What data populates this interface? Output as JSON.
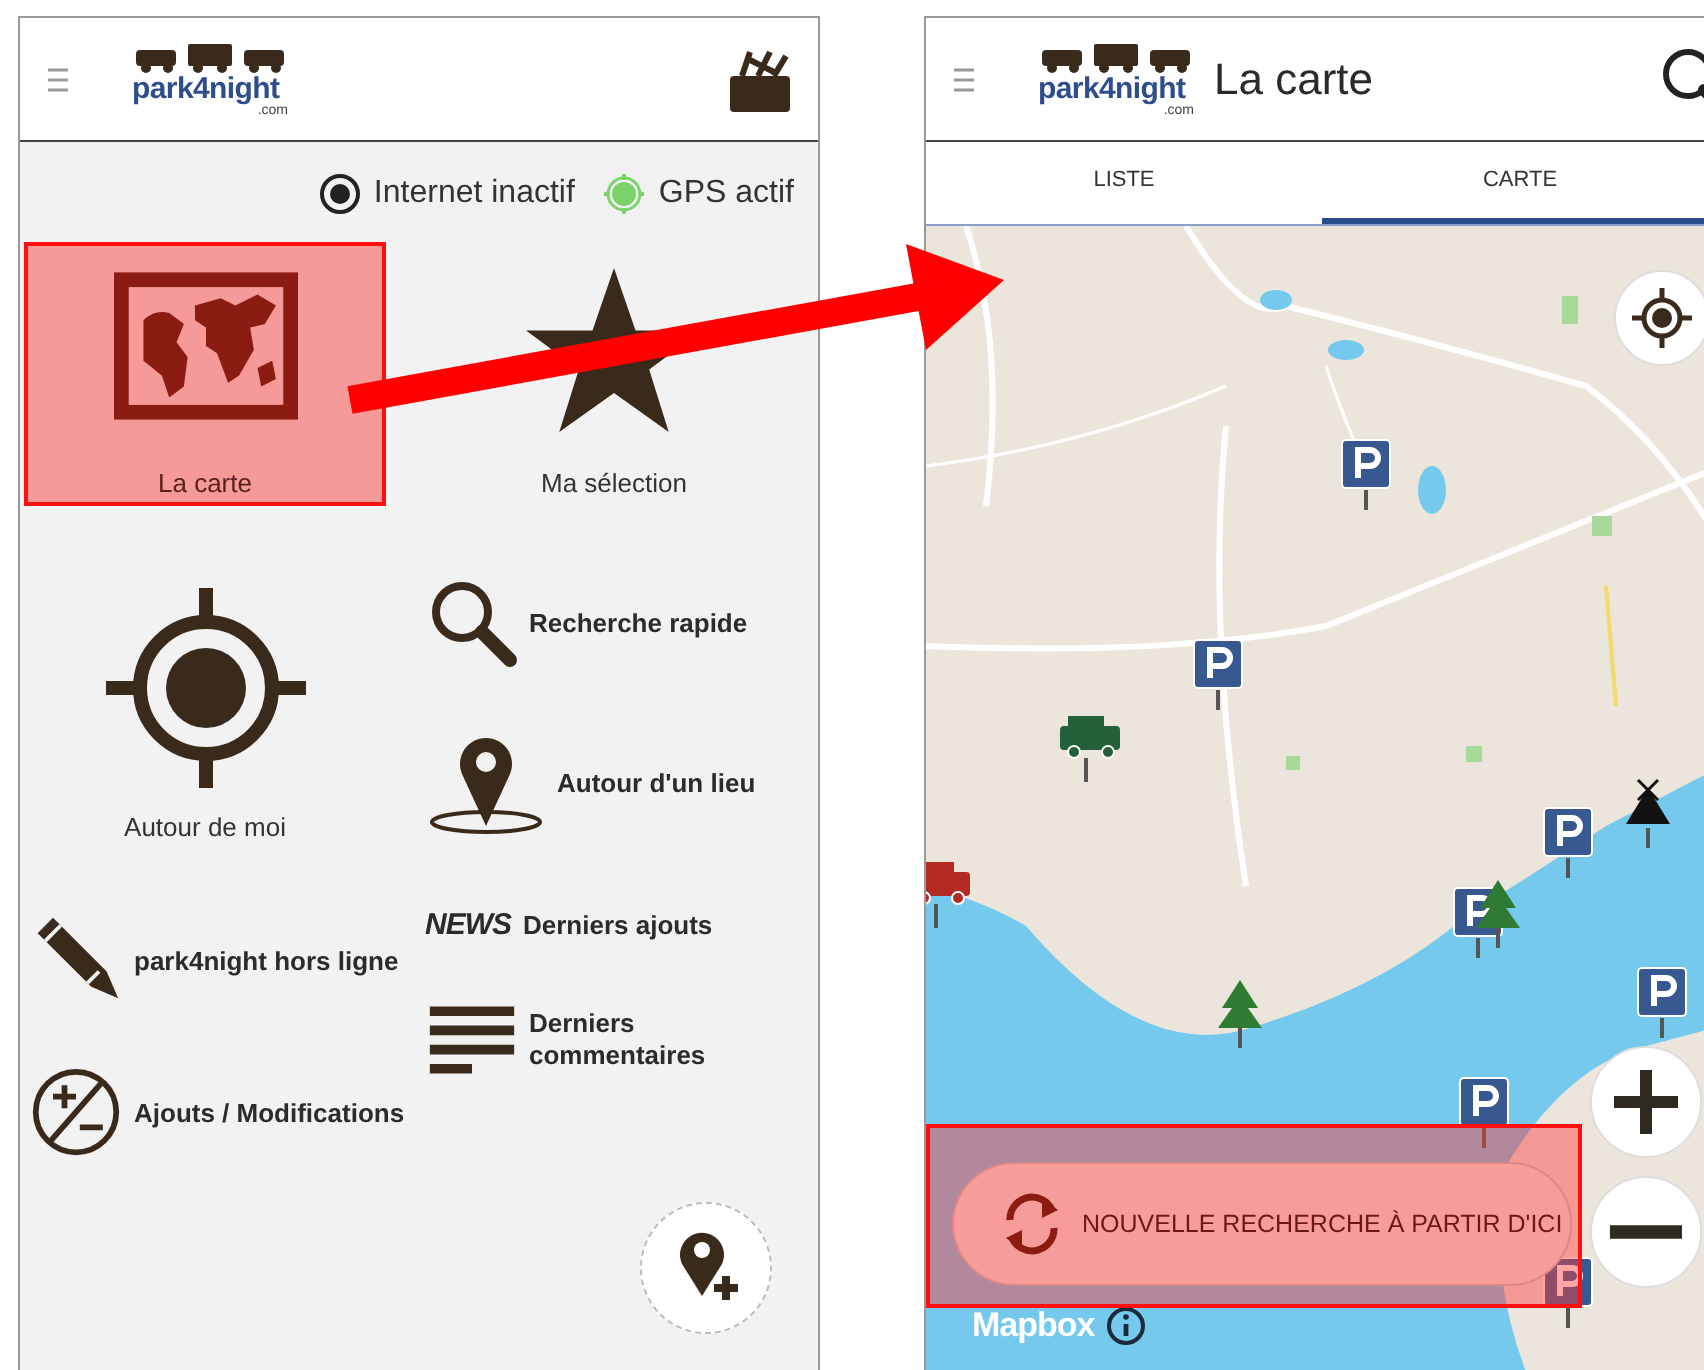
{
  "left_screen": {
    "header": {
      "logo": "park4night",
      "logo_domain": ".com"
    },
    "status": [
      {
        "kind": "internet",
        "label": "Internet inactif",
        "active": false
      },
      {
        "kind": "gps",
        "label": "GPS actif",
        "active": true
      }
    ],
    "menu_columns": [
      [
        {
          "kind": "tile",
          "label": "La carte",
          "highlighted": true
        },
        {
          "kind": "tile",
          "label": "Autour de moi",
          "highlighted": false
        },
        {
          "kind": "row",
          "label": "park4night hors ligne"
        },
        {
          "kind": "row",
          "label": "Ajouts / Modifications"
        }
      ],
      [
        {
          "kind": "tile",
          "label": "Ma sélection",
          "highlighted": false
        },
        {
          "kind": "row",
          "label": "Recherche rapide"
        },
        {
          "kind": "row",
          "label": "Autour d'un lieu"
        },
        {
          "kind": "row",
          "label": "Derniers ajouts",
          "icon_text": "NEWS"
        },
        {
          "kind": "row",
          "label": "Derniers commentaires"
        }
      ]
    ]
  },
  "right_screen": {
    "header": {
      "logo": "park4night",
      "logo_domain": ".com",
      "title": "La carte"
    },
    "tabs": [
      {
        "label": "LISTE",
        "selected": false
      },
      {
        "label": "CARTE",
        "selected": true
      }
    ],
    "search_here_button": {
      "label": "NOUVELLE RECHERCHE À PARTIR D'ICI",
      "highlighted": true
    },
    "attribution": "Mapbox"
  }
}
